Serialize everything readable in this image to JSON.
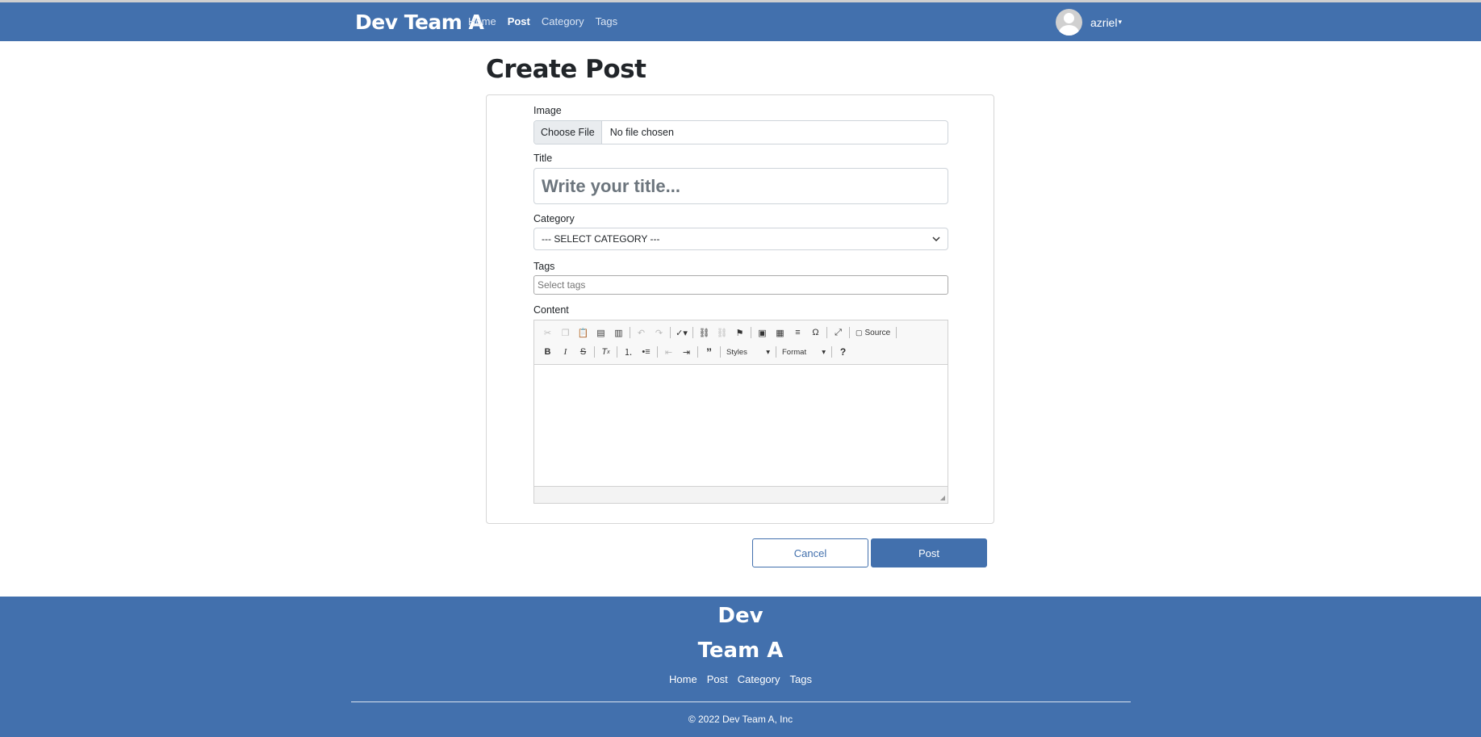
{
  "navbar": {
    "brand": "Dev Team A",
    "links": [
      {
        "label": "Home",
        "active": false
      },
      {
        "label": "Post",
        "active": true
      },
      {
        "label": "Category",
        "active": false
      },
      {
        "label": "Tags",
        "active": false
      }
    ],
    "username": "azriel",
    "caret": "▾"
  },
  "page": {
    "title": "Create Post"
  },
  "form": {
    "image_label": "Image",
    "file_button": "Choose File",
    "file_status": "No file chosen",
    "title_label": "Title",
    "title_placeholder": "Write your title...",
    "category_label": "Category",
    "category_selected": "--- SELECT CATEGORY ---",
    "tags_label": "Tags",
    "tags_placeholder": "Select tags",
    "content_label": "Content"
  },
  "editor": {
    "source_label": "Source",
    "styles_label": "Styles",
    "format_label": "Format",
    "help_label": "?"
  },
  "actions": {
    "cancel_label": "Cancel",
    "post_label": "Post"
  },
  "footer": {
    "brand_line1": "Dev",
    "brand_line2": "Team A",
    "links": [
      "Home",
      "Post",
      "Category",
      "Tags"
    ],
    "copyright": "© 2022 Dev Team A, Inc"
  },
  "colors": {
    "primary": "#4270ad",
    "text": "#212529"
  }
}
